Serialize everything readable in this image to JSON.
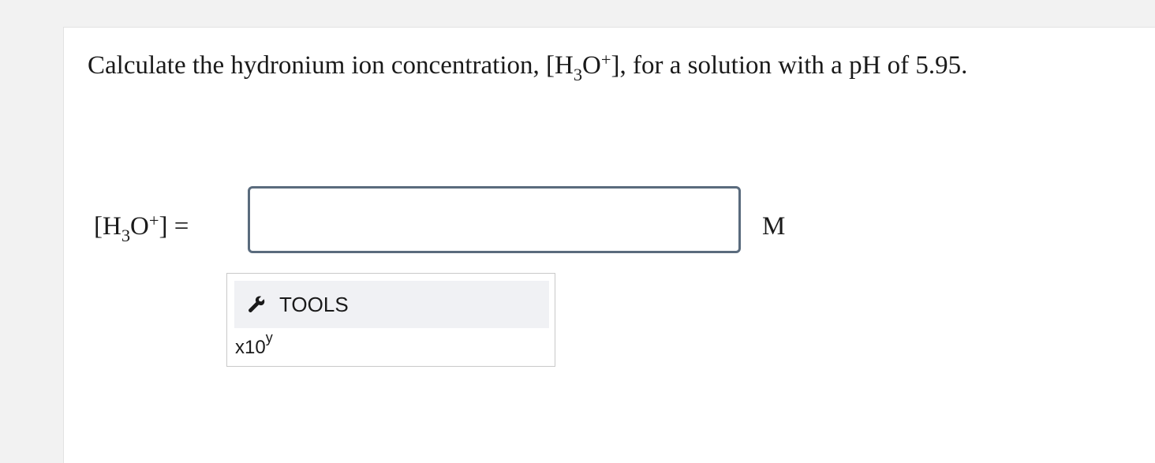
{
  "question": {
    "prefix": "Calculate the hydronium ion concentration, [H",
    "subscript": "3",
    "middle": "O",
    "superscript": "+",
    "suffix": "], for a solution with a pH of 5.95."
  },
  "answer": {
    "label_open": "[H",
    "label_subscript": "3",
    "label_middle": "O",
    "label_superscript": "+",
    "label_close": "] =",
    "input_value": "",
    "unit": "M"
  },
  "tools": {
    "icon": "wrench-icon",
    "label": "TOOLS",
    "sci_notation_base": "x10",
    "sci_notation_exponent": "y"
  },
  "colors": {
    "input_border": "#5a6b7d",
    "tools_header_bg": "#f0f1f4",
    "page_bg": "#f2f2f2"
  }
}
